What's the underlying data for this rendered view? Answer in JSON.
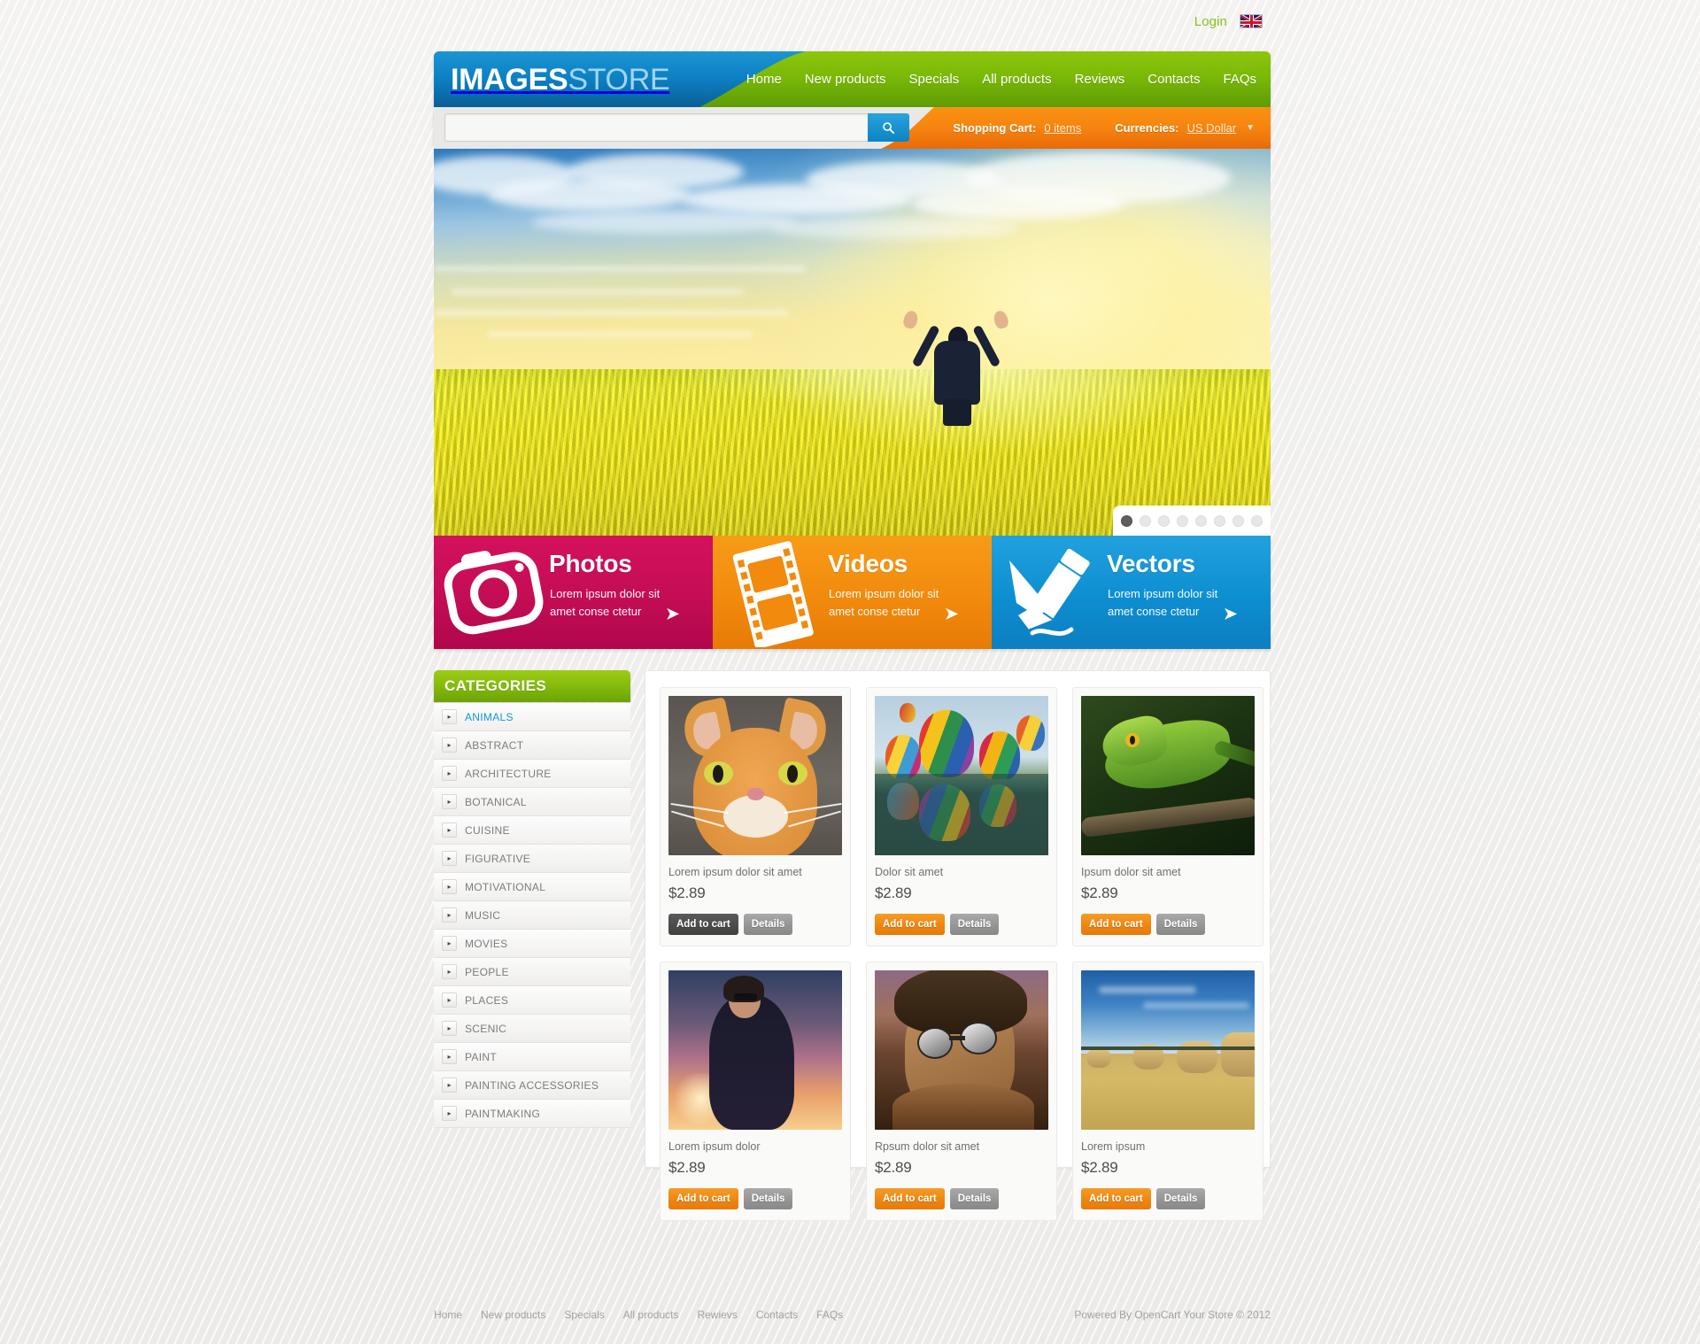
{
  "topbar": {
    "login_label": "Login",
    "flag": "uk-flag-icon"
  },
  "header": {
    "logo_bold": "IMAGES",
    "logo_light": "STORE",
    "nav": [
      {
        "label": "Home"
      },
      {
        "label": "New products"
      },
      {
        "label": "Specials"
      },
      {
        "label": "All products"
      },
      {
        "label": "Reviews"
      },
      {
        "label": "Contacts"
      },
      {
        "label": "FAQs"
      }
    ],
    "search": {
      "value": "",
      "placeholder": "",
      "button_icon": "search-icon"
    },
    "cart": {
      "label": "Shopping Cart:",
      "value": "0 items",
      "currency_label": "Currencies:",
      "currency_value": "US Dollar"
    }
  },
  "slider": {
    "dots": 8,
    "active_dot": 1
  },
  "promos": [
    {
      "title": "Photos",
      "text": "Lorem ipsum dolor sit amet conse ctetur",
      "icon": "camera-icon",
      "color": "#c30d54"
    },
    {
      "title": "Videos",
      "text": "Lorem ipsum dolor sit amet conse ctetur",
      "icon": "filmstrip-icon",
      "color": "#f18a0d"
    },
    {
      "title": "Vectors",
      "text": "Lorem ipsum dolor sit amet conse ctetur",
      "icon": "pen-pencil-icon",
      "color": "#0d8ed1"
    }
  ],
  "sidebar": {
    "title": "CATEGORIES",
    "items": [
      {
        "label": "ANIMALS",
        "active": true
      },
      {
        "label": "ABSTRACT",
        "active": false
      },
      {
        "label": "ARCHITECTURE",
        "active": false
      },
      {
        "label": "BOTANICAL",
        "active": false
      },
      {
        "label": "CUISINE",
        "active": false
      },
      {
        "label": "FIGURATIVE",
        "active": false
      },
      {
        "label": "MOTIVATIONAL",
        "active": false
      },
      {
        "label": "MUSIC",
        "active": false
      },
      {
        "label": "MOVIES",
        "active": false
      },
      {
        "label": "PEOPLE",
        "active": false
      },
      {
        "label": "PLACES",
        "active": false
      },
      {
        "label": "SCENIC",
        "active": false
      },
      {
        "label": "PAINT",
        "active": false
      },
      {
        "label": "PAINTING ACCESSORIES",
        "active": false
      },
      {
        "label": "PAINTMAKING",
        "active": false
      }
    ]
  },
  "buttons": {
    "add_to_cart": "Add to cart",
    "details": "Details"
  },
  "products": [
    {
      "title": "Lorem ipsum dolor sit amet",
      "price": "$2.89",
      "image": "orange-cat-photo",
      "cart_hover": true
    },
    {
      "title": "Dolor sit amet",
      "price": "$2.89",
      "image": "hot-air-balloons-photo",
      "cart_hover": false
    },
    {
      "title": "Ipsum dolor sit amet",
      "price": "$2.89",
      "image": "green-lizard-photo",
      "cart_hover": false
    },
    {
      "title": "Lorem ipsum dolor",
      "price": "$2.89",
      "image": "woman-sunset-photo",
      "cart_hover": false
    },
    {
      "title": "Rpsum dolor sit amet",
      "price": "$2.89",
      "image": "man-sunglasses-photo",
      "cart_hover": false
    },
    {
      "title": "Lorem ipsum",
      "price": "$2.89",
      "image": "hay-bales-field-photo",
      "cart_hover": false
    }
  ],
  "footer": {
    "links": [
      {
        "label": "Home"
      },
      {
        "label": "New products"
      },
      {
        "label": "Specials"
      },
      {
        "label": "All products"
      },
      {
        "label": "Rewievs"
      },
      {
        "label": "Contacts"
      },
      {
        "label": "FAQs"
      }
    ],
    "copyright": "Powered By OpenCart Your Store © 2012"
  },
  "colors": {
    "green": "#85bb0c",
    "blue": "#0d7fc2",
    "orange": "#f18a0d",
    "pink": "#c30d54",
    "link_blue": "#0e9ad8",
    "login_green": "#8bbd1d"
  }
}
